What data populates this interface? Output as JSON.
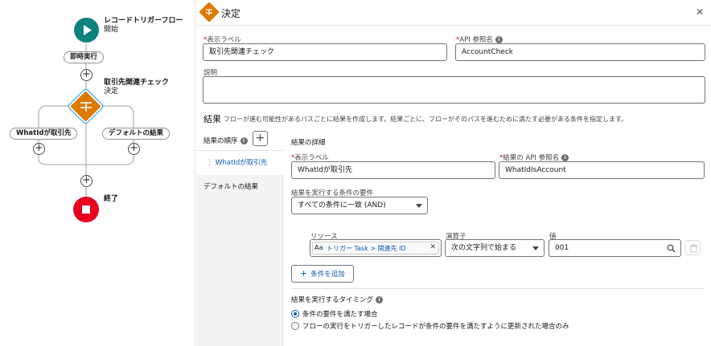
{
  "canvas": {
    "start": {
      "title": "レコードトリガーフロー",
      "subtitle": "開始"
    },
    "immediate_label": "即時実行",
    "decision": {
      "title": "取引先関連チェック",
      "subtitle": "決定"
    },
    "branch_left": "WhatIdが取引先",
    "branch_right": "デフォルトの結果",
    "end_label": "終了",
    "colors": {
      "start": "#0b827c",
      "decision": "#dd7a01",
      "end": "#ea001e",
      "wire": "#b4b4b4"
    }
  },
  "panel": {
    "title": "決定",
    "close_icon": "close-icon",
    "label_field": {
      "label": "表示ラベル",
      "value": "取引先関連チェック"
    },
    "api_field": {
      "label": "API 参照名",
      "value": "AccountCheck"
    },
    "description": {
      "label": "説明",
      "value": ""
    },
    "outcomes": {
      "title": "結果",
      "description": "フローが進む可能性があるパスごとに結果を作成します。結果ごとに、フローがそのパスを進むために満たす必要がある条件を指定します。",
      "order_label": "結果の順序",
      "items": [
        {
          "label": "WhatIdが取引先"
        },
        {
          "label": "デフォルトの結果"
        }
      ]
    },
    "detail": {
      "section_title": "結果の詳細",
      "label_field": {
        "label": "表示ラベル",
        "value": "WhatIdが取引先"
      },
      "api_field": {
        "label": "結果の API 参照名",
        "value": "WhatIdIsAccount"
      },
      "condition_req": {
        "label": "結果を実行する条件の要件",
        "value": "すべての条件に一致 (AND)"
      },
      "condition": {
        "resource_label": "リソース",
        "resource_value": "トリガー Task > 関連先 ID",
        "resource_prefix": "Aa",
        "operator_label": "演算子",
        "operator_value": "次の文字列で始まる",
        "value_label": "値",
        "value_value": "001"
      },
      "add_condition": "条件を追加",
      "timing": {
        "title": "結果を実行するタイミング",
        "options": [
          {
            "label": "条件の要件を満たす場合",
            "selected": true
          },
          {
            "label": "フローの実行をトリガーしたレコードが条件の要件を満たすように更新された場合のみ",
            "selected": false
          }
        ]
      }
    },
    "accent": "#0b5cab"
  }
}
